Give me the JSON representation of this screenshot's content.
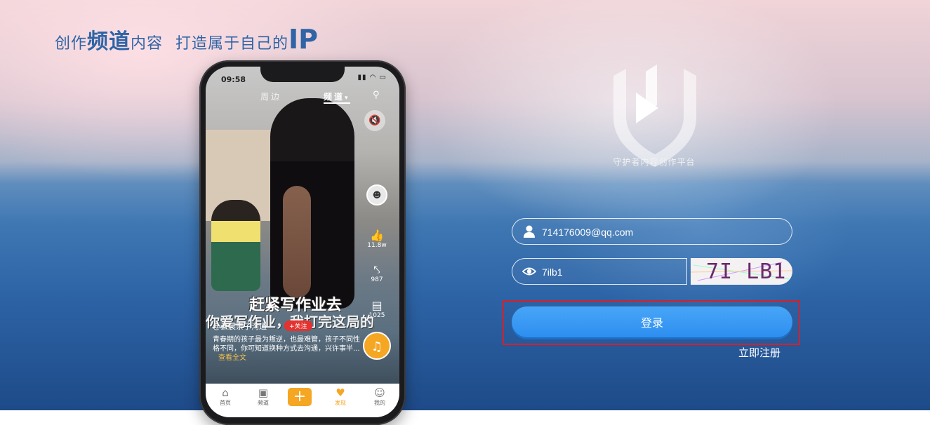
{
  "slogan": {
    "part1": "创作",
    "em": "频道",
    "part2": "内容",
    "part3": "打造属于自己的",
    "ip": "IP"
  },
  "phone": {
    "time": "09:58",
    "tabs": {
      "nearby": "周边",
      "channel": "频道",
      "channel_caret": "▾"
    },
    "side": {
      "likes": "11.8w",
      "shares": "987",
      "comments": "1025"
    },
    "overlay_title": "赶紧写作业去",
    "overlay_sub": "你爱写作业，我打完这局的",
    "author": "@云晨亲子沟通",
    "follow": "+关注",
    "description": "青春期的孩子最为叛逆，也最难管，孩子不同性格不同，你可知道换种方式去沟通，兴许事半...",
    "see_full": "查看全文",
    "nav": [
      {
        "label": "首页",
        "icon": "home-icon"
      },
      {
        "label": "频道",
        "icon": "channel-icon"
      },
      {
        "label": "发现",
        "icon": "discover-icon"
      },
      {
        "label": "我的",
        "icon": "profile-icon"
      }
    ],
    "add_symbol": "+"
  },
  "brand": {
    "name": "守护者内容创作平台"
  },
  "form": {
    "username": "714176009@qq.com",
    "captcha_input": "7ilb1",
    "captcha_image_text": "7I LB1",
    "login_label": "登录",
    "register_label": "立即注册"
  },
  "colors": {
    "primary": "#3d9bf3",
    "highlight_border": "#d81f2a",
    "slogan": "#2f64a6",
    "accent": "#f5a623"
  }
}
